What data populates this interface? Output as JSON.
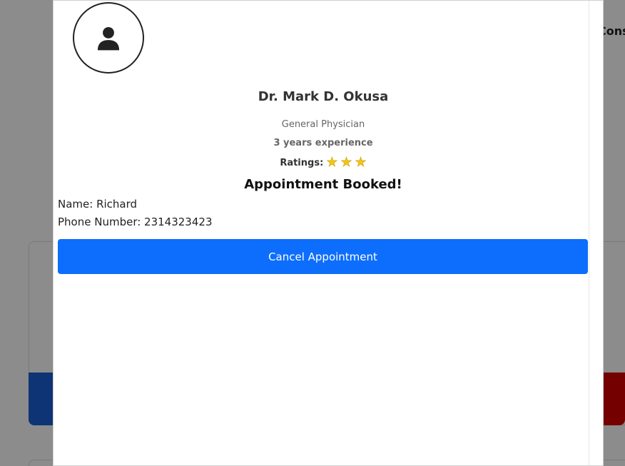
{
  "background": {
    "nav_partial_text": "Cons"
  },
  "doctor": {
    "avatar_icon": "user-icon",
    "name": "Dr. Mark D. Okusa",
    "specialty": "General Physician",
    "experience": "3 years experience",
    "ratings_label": "Ratings:",
    "stars": [
      "★",
      "★",
      "★"
    ],
    "star_icon": "star-icon",
    "star_color": "#f5c518"
  },
  "appointment": {
    "status": "Appointment Booked!",
    "name_line": "Name: Richard",
    "phone_line": "Phone Number: 2314323423",
    "cancel_label": "Cancel Appointment"
  },
  "colors": {
    "primary": "#0d6efd",
    "danger": "#d40000"
  }
}
